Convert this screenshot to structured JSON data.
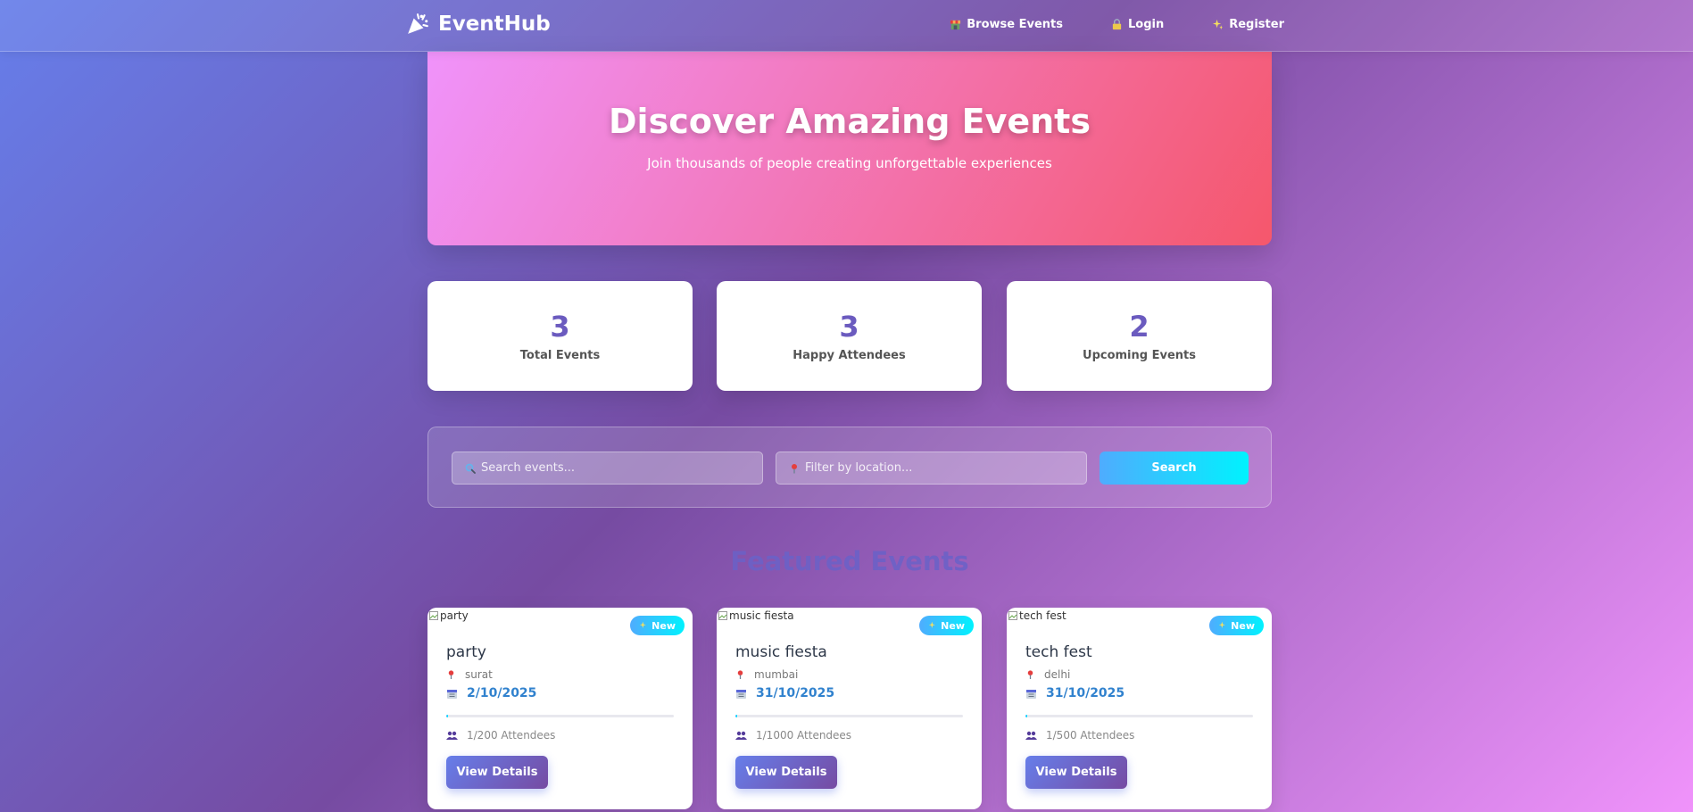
{
  "nav": {
    "brand": "EventHub",
    "links": [
      {
        "label": "Browse Events",
        "icon": "store-icon"
      },
      {
        "label": "Login",
        "icon": "lock-icon"
      },
      {
        "label": "Register",
        "icon": "sparkles-icon"
      }
    ]
  },
  "hero": {
    "title": "Discover Amazing Events",
    "subtitle": "Join thousands of people creating unforgettable experiences"
  },
  "stats": [
    {
      "value": "3",
      "label": "Total Events"
    },
    {
      "value": "3",
      "label": "Happy Attendees"
    },
    {
      "value": "2",
      "label": "Upcoming Events"
    }
  ],
  "search": {
    "search_placeholder": "Search events...",
    "location_placeholder": "Filter by location...",
    "button_label": "Search"
  },
  "featured": {
    "title": "Featured Events",
    "badge_label": "New",
    "details_label": "View Details",
    "events": [
      {
        "image_alt": "party",
        "title": "party",
        "location": "surat",
        "date": "2/10/2025",
        "attendees": "1/200 Attendees",
        "fill": 0.005
      },
      {
        "image_alt": "music fiesta",
        "title": "music fiesta",
        "location": "mumbai",
        "date": "31/10/2025",
        "attendees": "1/1000 Attendees",
        "fill": 0.001
      },
      {
        "image_alt": "tech fest",
        "title": "tech fest",
        "location": "delhi",
        "date": "31/10/2025",
        "attendees": "1/500 Attendees",
        "fill": 0.002
      }
    ]
  },
  "colors": {
    "accent": "#667eea",
    "hero_start": "#f093fb",
    "hero_end": "#f5576c",
    "stat_number": "#6b5bbf",
    "date": "#3182ce",
    "badge": "#4facfe"
  }
}
